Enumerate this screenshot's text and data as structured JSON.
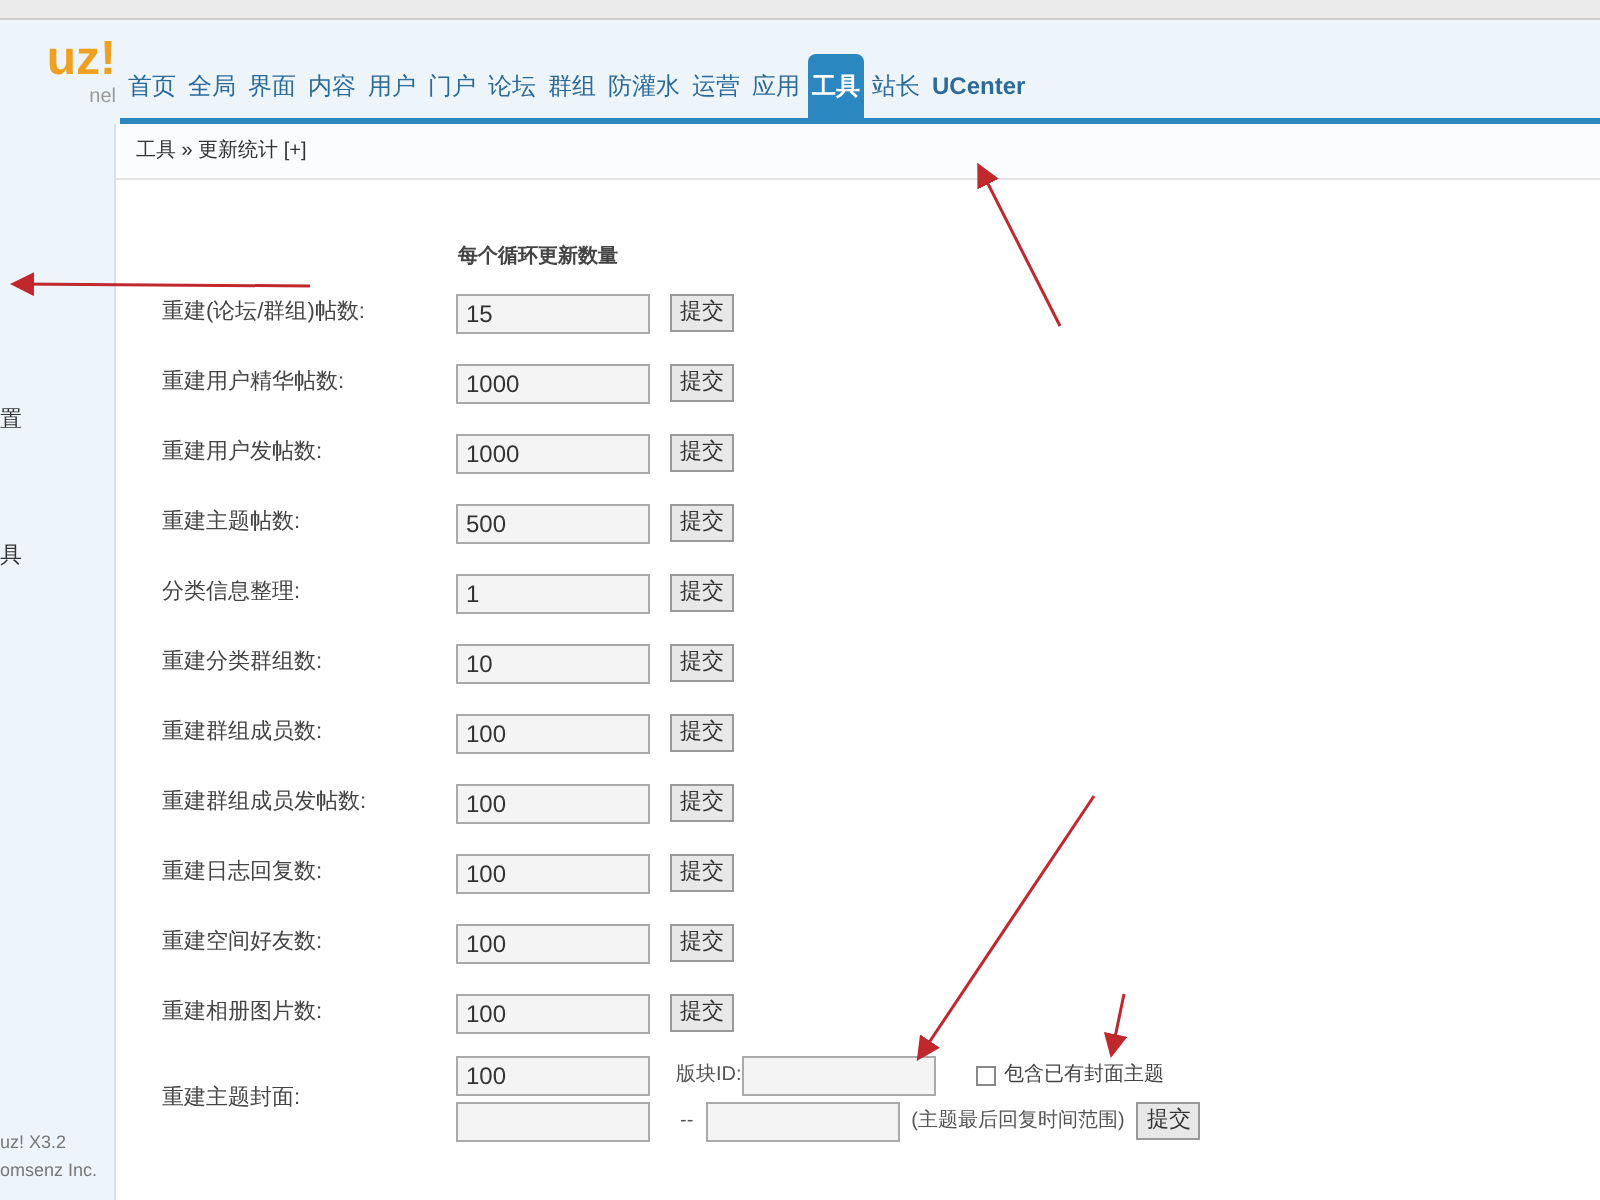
{
  "logo": {
    "text": "uz!",
    "subtitle": "nel"
  },
  "nav_tabs": [
    {
      "label": "首页",
      "selected": false
    },
    {
      "label": "全局",
      "selected": false
    },
    {
      "label": "界面",
      "selected": false
    },
    {
      "label": "内容",
      "selected": false
    },
    {
      "label": "用户",
      "selected": false
    },
    {
      "label": "门户",
      "selected": false
    },
    {
      "label": "论坛",
      "selected": false
    },
    {
      "label": "群组",
      "selected": false
    },
    {
      "label": "防灌水",
      "selected": false
    },
    {
      "label": "运营",
      "selected": false
    },
    {
      "label": "应用",
      "selected": false
    },
    {
      "label": "工具",
      "selected": true
    },
    {
      "label": "站长",
      "selected": false
    },
    {
      "label": "UCenter",
      "selected": false
    }
  ],
  "breadcrumb": "工具 » 更新统计 [+]",
  "sidebar": {
    "items": [
      "置",
      "具"
    ],
    "version": "uz! X3.2",
    "company": "omsenz Inc."
  },
  "form": {
    "column_header": "每个循环更新数量",
    "rows": [
      {
        "kind": "simple",
        "label": "重建(论坛/群组)帖数:",
        "value": "15",
        "button": "提交"
      },
      {
        "kind": "simple",
        "label": "重建用户精华帖数:",
        "value": "1000",
        "button": "提交"
      },
      {
        "kind": "simple",
        "label": "重建用户发帖数:",
        "value": "1000",
        "button": "提交"
      },
      {
        "kind": "simple",
        "label": "重建主题帖数:",
        "value": "500",
        "button": "提交"
      },
      {
        "kind": "simple",
        "label": "分类信息整理:",
        "value": "1",
        "button": "提交"
      },
      {
        "kind": "simple",
        "label": "重建分类群组数:",
        "value": "10",
        "button": "提交"
      },
      {
        "kind": "simple",
        "label": "重建群组成员数:",
        "value": "100",
        "button": "提交"
      },
      {
        "kind": "simple",
        "label": "重建群组成员发帖数:",
        "value": "100",
        "button": "提交"
      },
      {
        "kind": "simple",
        "label": "重建日志回复数:",
        "value": "100",
        "button": "提交"
      },
      {
        "kind": "simple",
        "label": "重建空间好友数:",
        "value": "100",
        "button": "提交"
      },
      {
        "kind": "simple",
        "label": "重建相册图片数:",
        "value": "100",
        "button": "提交"
      },
      {
        "kind": "cover",
        "label": "重建主题封面:",
        "value": "100",
        "forum_id_label": "版块ID:",
        "checkbox": {
          "label": "包含已有封面主题",
          "checked": false
        },
        "range_separator": "--",
        "range_hint": "(主题最后回复时间范围)",
        "button": "提交"
      }
    ]
  }
}
